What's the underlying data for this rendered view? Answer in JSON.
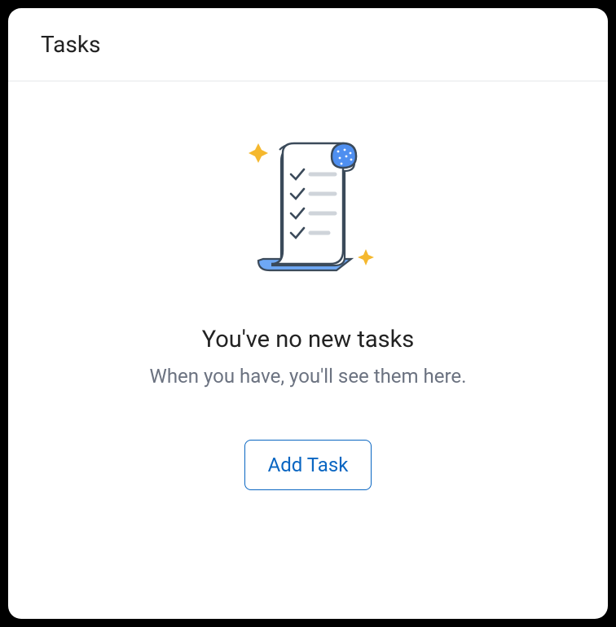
{
  "header": {
    "title": "Tasks"
  },
  "empty_state": {
    "title": "You've no new tasks",
    "subtitle": "When you have, you'll see them here.",
    "button_label": "Add Task"
  }
}
